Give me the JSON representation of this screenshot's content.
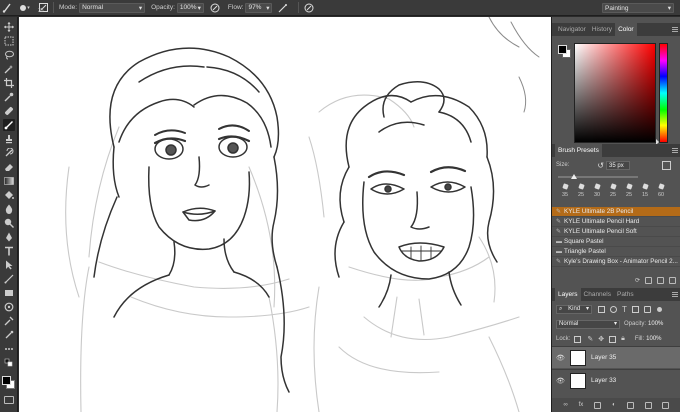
{
  "options_bar": {
    "brush_size": "35",
    "mode_label": "Mode:",
    "mode_value": "Normal",
    "opacity_label": "Opacity:",
    "opacity_value": "100%",
    "flow_label": "Flow:",
    "flow_value": "97%",
    "workspace": "Painting"
  },
  "color_panel": {
    "tabs": [
      "Navigator",
      "History",
      "Color"
    ],
    "active_tab": "Color",
    "foreground": "#000000",
    "background": "#ffffff"
  },
  "brush_presets": {
    "title": "Brush Presets",
    "size_label": "Size:",
    "size_value": "35 px",
    "tip_sizes": [
      "35",
      "25",
      "30",
      "25",
      "25",
      "15",
      "60"
    ],
    "items": [
      "KYLE Ultimate 2B Pencil",
      "KYLE Ultimate Pencil Hard",
      "KYLE Ultimate Pencil Soft",
      "Square Pastel",
      "Triangle Pastel",
      "Kyle's Drawing Box - Animator Pencil 2..."
    ],
    "selected_index": 0
  },
  "layers_panel": {
    "tabs": [
      "Layers",
      "Channels",
      "Paths"
    ],
    "active_tab": "Layers",
    "kind_label": "Kind",
    "blend_mode": "Normal",
    "opacity_label": "Opacity:",
    "opacity_value": "100%",
    "lock_label": "Lock:",
    "fill_label": "Fill:",
    "fill_value": "100%",
    "layers": [
      "Layer 35",
      "Layer 33"
    ],
    "selected_layer": "Layer 35"
  },
  "colors": {
    "selection_orange": "#b46b18",
    "panel_bg": "#535353",
    "chrome_bg": "#3a3a3a"
  }
}
